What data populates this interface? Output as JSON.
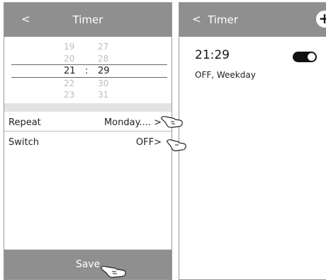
{
  "left": {
    "header": {
      "back": "<",
      "title": "Timer"
    },
    "picker": {
      "hours": [
        "19",
        "20",
        "21",
        "22",
        "23"
      ],
      "minutes": [
        "27",
        "28",
        "29",
        "30",
        "31"
      ],
      "separator": ":"
    },
    "repeat": {
      "label": "Repeat",
      "value": "Monday.... >"
    },
    "switch": {
      "label": "Switch",
      "value": "OFF>"
    },
    "save_label": "Save"
  },
  "right": {
    "header": {
      "back": "<",
      "title": "Timer",
      "add": "+"
    },
    "timer": {
      "time": "21:29",
      "desc": "OFF, Weekday",
      "toggle_on": true
    }
  }
}
